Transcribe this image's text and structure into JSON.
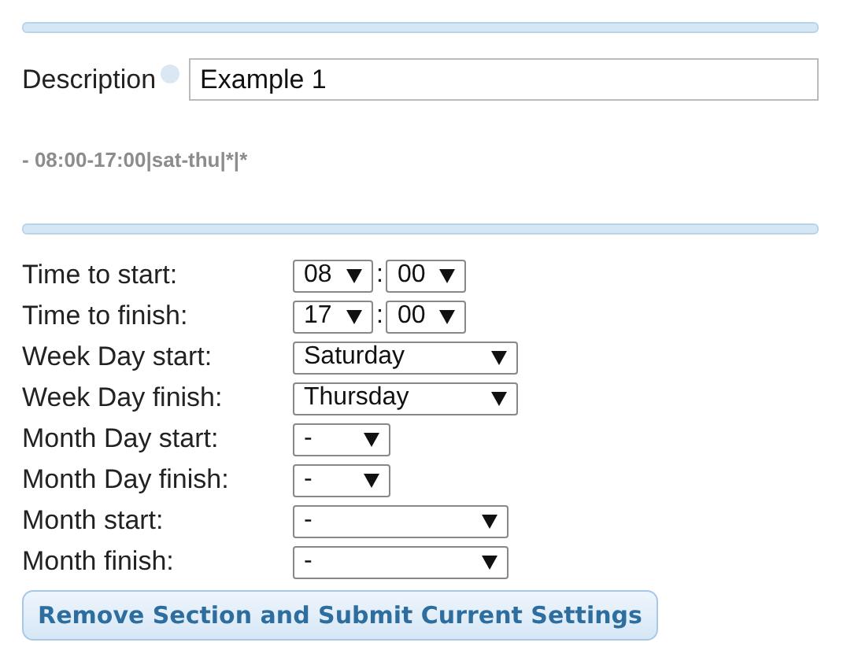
{
  "description": {
    "label": "Description",
    "value": "Example 1"
  },
  "summary": "- 08:00-17:00|sat-thu|*|*",
  "fields": [
    {
      "label": "Time to start:",
      "kind": "time",
      "hour": "08",
      "separator": ":",
      "minute": "00"
    },
    {
      "label": "Time to finish:",
      "kind": "time",
      "hour": "17",
      "separator": ":",
      "minute": "00"
    },
    {
      "label": "Week Day start:",
      "kind": "weekday",
      "value": "Saturday"
    },
    {
      "label": "Week Day finish:",
      "kind": "weekday",
      "value": "Thursday"
    },
    {
      "label": "Month Day start:",
      "kind": "monthday",
      "value": "-"
    },
    {
      "label": "Month Day finish:",
      "kind": "monthday",
      "value": "-"
    },
    {
      "label": "Month start:",
      "kind": "month",
      "value": "-"
    },
    {
      "label": "Month finish:",
      "kind": "month",
      "value": "-"
    }
  ],
  "button": "Remove Section and Submit Current Settings"
}
